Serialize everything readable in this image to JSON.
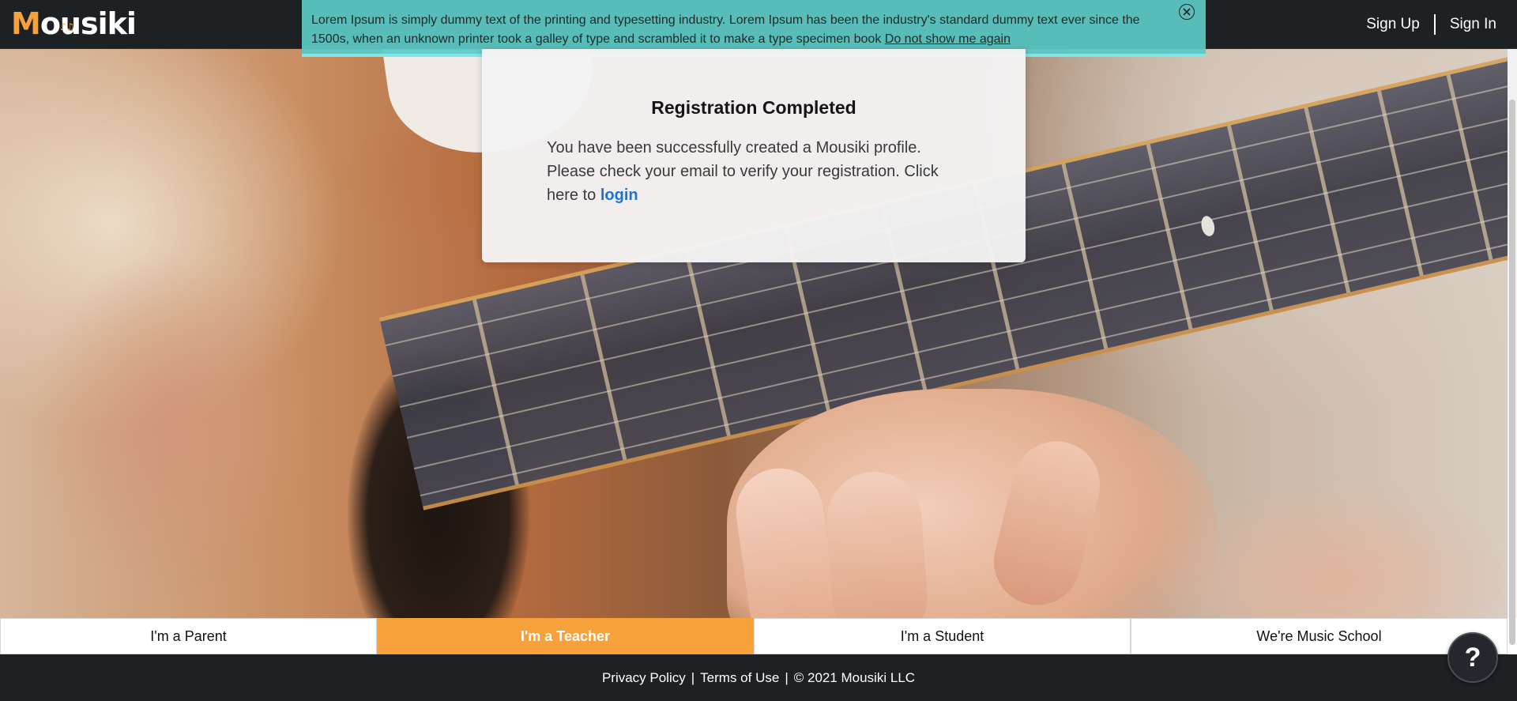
{
  "header": {
    "logo_first_letter": "M",
    "logo_rest": "ousiki",
    "sign_up_label": "Sign Up",
    "sign_in_label": "Sign In"
  },
  "notice": {
    "text": "Lorem Ipsum is simply dummy text of the printing and typesetting industry. Lorem Ipsum has been the industry's standard dummy text ever since the 1500s, when an unknown printer took a galley of type and scrambled it to make a type specimen book",
    "dismiss_label": "Do not show me again"
  },
  "card": {
    "title": "Registration Completed",
    "message": "You have been successfully created a Mousiki profile. Please check your email to verify your registration. Click here to",
    "login_label": "login"
  },
  "tabs": [
    {
      "label": "I'm a Parent",
      "active": false
    },
    {
      "label": "I'm a Teacher",
      "active": true
    },
    {
      "label": "I'm a Student",
      "active": false
    },
    {
      "label": "We're Music School",
      "active": false
    }
  ],
  "footer": {
    "privacy_label": "Privacy Policy",
    "terms_label": "Terms of Use",
    "copyright": "© 2021 Mousiki LLC",
    "separator": "|"
  },
  "help": {
    "label": "?"
  },
  "icons": {
    "close": "close-circle-icon",
    "help": "question-mark-icon"
  },
  "colors": {
    "brand_orange": "#f7a13a",
    "header_bg": "#1e2124",
    "notice_bg": "#5dc8c4",
    "link_blue": "#1a73d9"
  }
}
